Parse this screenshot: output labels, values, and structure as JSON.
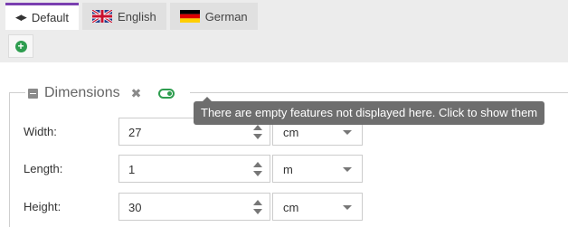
{
  "tabs": [
    {
      "label": "Default",
      "icon": "language-arrows-icon",
      "active": true
    },
    {
      "label": "English",
      "icon": "uk-flag-icon",
      "active": false
    },
    {
      "label": "German",
      "icon": "germany-flag-icon",
      "active": false
    }
  ],
  "add_button": {
    "icon": "plus-circle-icon"
  },
  "fieldset": {
    "title": "Dimensions",
    "remove_icon": "close-icon",
    "toggle_icon": "toggle-on-icon"
  },
  "tooltip": "There are empty features not displayed here. Click to show them",
  "fields": [
    {
      "label": "Width:",
      "value": "27",
      "unit": "cm"
    },
    {
      "label": "Length:",
      "value": "1",
      "unit": "m"
    },
    {
      "label": "Height:",
      "value": "30",
      "unit": "cm"
    }
  ],
  "colors": {
    "accent": "#7a3fb0",
    "success": "#2e9d4f",
    "tooltip_bg": "#6e6e6e",
    "toolbar_bg": "#ececec"
  }
}
